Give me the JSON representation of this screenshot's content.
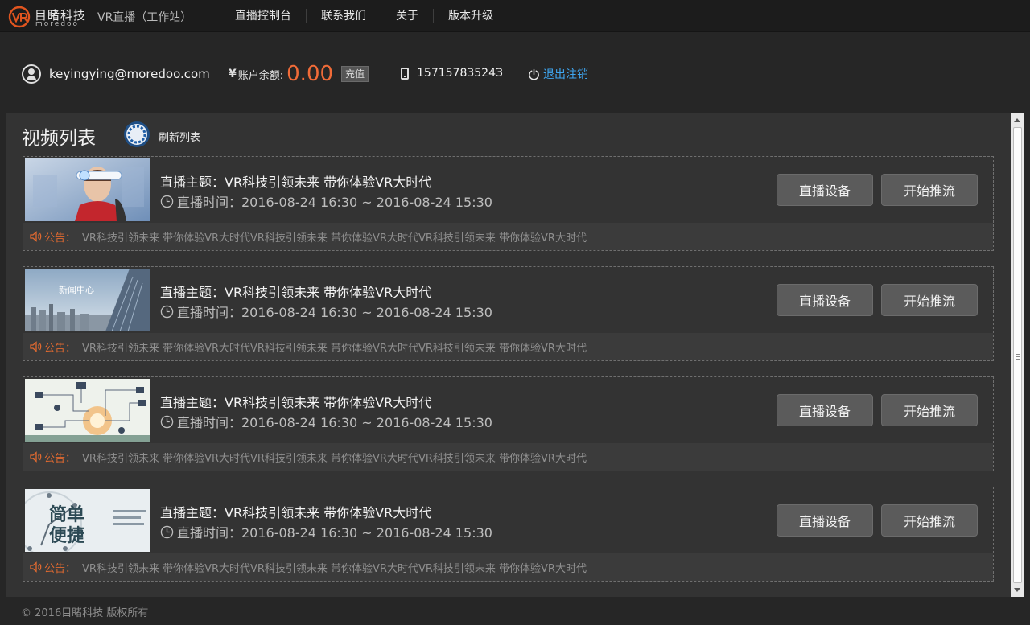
{
  "brand": {
    "logo_cn": "目睹科技",
    "logo_en": "moredoo",
    "app_title": "VR直播（工作站）",
    "accent_color": "#f06b38"
  },
  "nav": {
    "items": [
      {
        "label": "直播控制台"
      },
      {
        "label": "联系我们"
      },
      {
        "label": "关于"
      },
      {
        "label": "版本升级"
      }
    ]
  },
  "account": {
    "email": "keyingying@moredoo.com",
    "yen_symbol": "¥",
    "balance_label": "账户余额:",
    "balance_value": "0.00",
    "recharge_label": "充值",
    "phone": "15715783524З",
    "logout_label": "退出注销",
    "icons": [
      "user-icon",
      "yen-icon",
      "phone-icon",
      "power-icon"
    ]
  },
  "video_list": {
    "title": "视频列表",
    "refresh_label": "刷新列表",
    "items": [
      {
        "title": "直播主题：VR科技引领未来 带你体验VR大时代",
        "time": "直播时间：2016-08-24 16:30 ~ 2016-08-24 15:30",
        "device_label": "直播设备",
        "push_label": "开始推流",
        "notice_label": "公告：",
        "notice_text": "VR科技引领未来 带你体验VR大时代VR科技引领未来 带你体验VR大时代VR科技引领未来 带你体验VR大时代",
        "thumb": "vr-headset-woman"
      },
      {
        "title": "直播主题：VR科技引领未来 带你体验VR大时代",
        "time": "直播时间：2016-08-24 16:30 ~ 2016-08-24 15:30",
        "device_label": "直播设备",
        "push_label": "开始推流",
        "notice_label": "公告：",
        "notice_text": "VR科技引领未来 带你体验VR大时代VR科技引领未来 带你体验VR大时代VR科技引领未来 带你体验VR大时代",
        "thumb": "news-center-city",
        "thumb_caption": "新闻中心"
      },
      {
        "title": "直播主题：VR科技引领未来 带你体验VR大时代",
        "time": "直播时间：2016-08-24 16:30 ~ 2016-08-24 15:30",
        "device_label": "直播设备",
        "push_label": "开始推流",
        "notice_label": "公告：",
        "notice_text": "VR科技引领未来 带你体验VR大时代VR科技引领未来 带你体验VR大时代VR科技引领未来 带你体验VR大时代",
        "thumb": "network-diagram"
      },
      {
        "title": "直播主题：VR科技引领未来 带你体验VR大时代",
        "time": "直播时间：2016-08-24 16:30 ~ 2016-08-24 15:30",
        "device_label": "直播设备",
        "push_label": "开始推流",
        "notice_label": "公告：",
        "notice_text": "VR科技引领未来 带你体验VR大时代VR科技引领未来 带你体验VR大时代VR科技引领未来 带你体验VR大时代",
        "thumb": "simple-convenient-clock",
        "thumb_caption": "简单便捷"
      }
    ]
  },
  "footer": {
    "copyright": "© 2016目睹科技  版权所有"
  }
}
